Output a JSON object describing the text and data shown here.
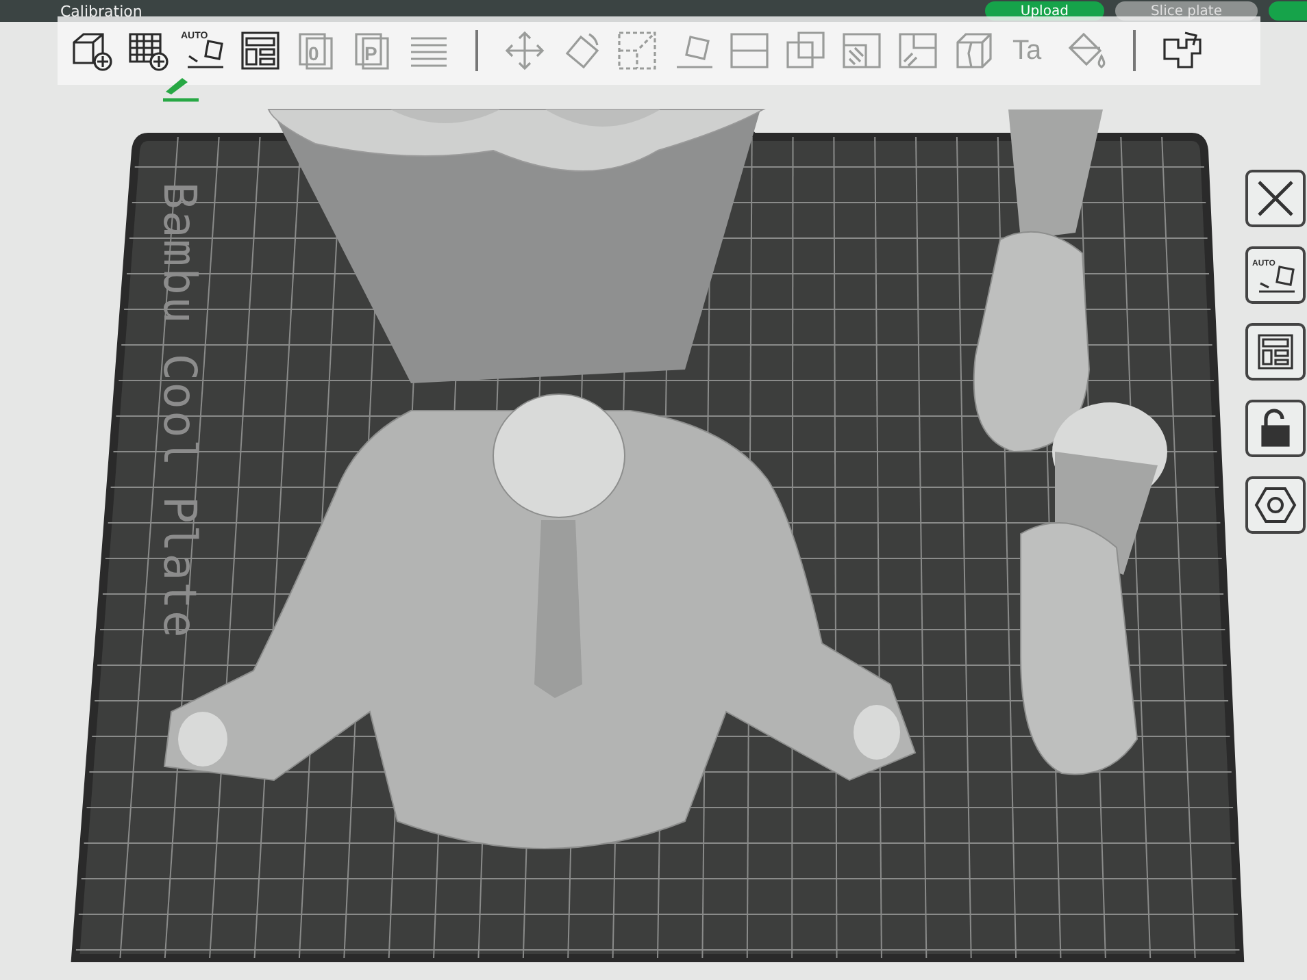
{
  "top_bar": {
    "title": "Calibration",
    "buttons": [
      {
        "label": "Upload",
        "kind": "primary"
      },
      {
        "label": "Slice plate",
        "kind": "secondary"
      }
    ]
  },
  "toolbar": [
    {
      "kind": "tool",
      "disabled": false
    },
    {
      "kind": "tool",
      "disabled": false
    },
    {
      "kind": "tool",
      "disabled": false,
      "label": "AUTO"
    },
    {
      "kind": "tool",
      "disabled": false
    },
    {
      "kind": "tool",
      "disabled": true,
      "label": "0"
    },
    {
      "kind": "tool",
      "disabled": true,
      "label": "P"
    },
    {
      "kind": "tool",
      "disabled": true
    },
    {
      "kind": "separator"
    },
    {
      "kind": "tool",
      "disabled": true
    },
    {
      "kind": "tool",
      "disabled": true
    },
    {
      "kind": "tool",
      "disabled": true
    },
    {
      "kind": "tool",
      "disabled": true
    },
    {
      "kind": "tool",
      "disabled": true
    },
    {
      "kind": "tool",
      "disabled": true
    },
    {
      "kind": "tool",
      "disabled": true
    },
    {
      "kind": "tool",
      "disabled": true
    },
    {
      "kind": "tool",
      "disabled": true
    },
    {
      "kind": "tool",
      "disabled": true,
      "label": "Ta"
    },
    {
      "kind": "tool",
      "disabled": true
    },
    {
      "kind": "separator"
    },
    {
      "kind": "tool",
      "disabled": false
    }
  ],
  "plate": {
    "label": "Bambu Cool Plate"
  },
  "plate_tools": [
    {
      "kind": "close"
    },
    {
      "kind": "auto",
      "label": "AUTO"
    },
    {
      "kind": "arrange"
    },
    {
      "kind": "lock"
    },
    {
      "kind": "settings"
    }
  ]
}
